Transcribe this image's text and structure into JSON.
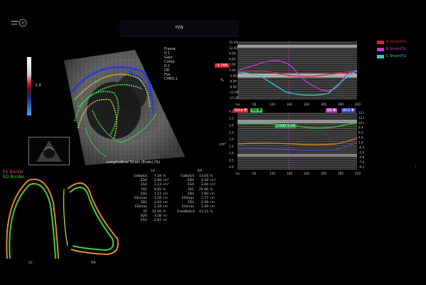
{
  "window": {
    "title": "n/a"
  },
  "logo": {
    "text": ""
  },
  "ultrasound": {
    "caption": "Longitudinal Strain (Endo) (%)",
    "colorbar": {
      "top": "",
      "mid": "-1.4",
      "bottom": ""
    },
    "params": [
      "Frame",
      "0.1",
      "Gain",
      "Comp",
      "0.1",
      "DR",
      "Fps",
      "CHRS-1"
    ]
  },
  "es_legend": [
    {
      "label": "ES Border",
      "color": "#e34a3a"
    },
    {
      "label": "ED Border",
      "color": "#37d14a"
    }
  ],
  "contours": {
    "lv_label": "LV",
    "ra_label": "RA"
  },
  "measurements": {
    "columns": [
      {
        "header": "LV",
        "rows": [
          {
            "name": "GobalLS",
            "value": "-7.28",
            "unit": "%"
          },
          {
            "name": "EDA",
            "value": "2.88",
            "unit": "cm²"
          },
          {
            "name": "ESA",
            "value": "2.23",
            "unit": "cm²"
          },
          {
            "name": "FAC",
            "value": "9.85",
            "unit": "%"
          },
          {
            "name": "EDL",
            "value": "1.11",
            "unit": "cm"
          },
          {
            "name": "ESLmax",
            "value": "3.26",
            "unit": "cm"
          },
          {
            "name": "EDL",
            "value": "2.93",
            "unit": "cm"
          },
          {
            "name": "ESlmax",
            "value": "2.28",
            "unit": "cm"
          },
          {
            "name": "EF",
            "value": "12.56",
            "unit": "%"
          },
          {
            "name": "EDV",
            "value": "3.28",
            "unit": "ml"
          },
          {
            "name": "ESV",
            "value": "2.87",
            "unit": "ml"
          }
        ]
      },
      {
        "header": "RA",
        "rows": [
          {
            "name": "GobalLS",
            "value": "-13.64",
            "unit": "%"
          },
          {
            "name": "EDA",
            "value": "4.58",
            "unit": "cm²"
          },
          {
            "name": "ESA",
            "value": "3.44",
            "unit": "cm²"
          },
          {
            "name": "FAC",
            "value": "25.06",
            "unit": "%"
          },
          {
            "name": "EDL",
            "value": "1.80",
            "unit": "cm"
          },
          {
            "name": "ESlmax",
            "value": "1.77",
            "unit": "cm"
          },
          {
            "name": "EDL",
            "value": "2.08",
            "unit": "cm"
          },
          {
            "name": "ESlmax",
            "value": "1.49",
            "unit": "cm"
          },
          {
            "name": "FreeWallLS",
            "value": "-11.15",
            "unit": "%"
          }
        ]
      }
    ]
  },
  "graph1": {
    "y_ticks": [
      "15.00",
      "12.00",
      "9.00",
      "6.00",
      "3.00",
      "0.00",
      "-3.00",
      "-6.00",
      "-9.00",
      "-12.00",
      "-15.00"
    ],
    "x_ticks": [
      "ms",
      "60",
      "120",
      "180",
      "240",
      "300",
      "360",
      "420"
    ],
    "y_axis_label": "%",
    "marker_label": "-5.066",
    "marker_label_color": "#e3232e"
  },
  "graph2": {
    "y_ticks_left": [
      "4.0",
      "3.5",
      "3.0",
      "2.5",
      "2.0",
      "1.5",
      "1.0",
      "0.5",
      "0.0"
    ],
    "y_ticks_right": [
      "15.0",
      "12.8",
      "10.6",
      "8.4",
      "6.2",
      "4.0",
      "1.8",
      "-0.4",
      "-2.6",
      "-4.8",
      "-7.0",
      "-9.2"
    ],
    "x_ticks": [
      "ms",
      "60",
      "120",
      "180",
      "240",
      "300",
      "360",
      "420"
    ],
    "y_axis_label": "cm²",
    "area_label": "Area ▼",
    "area_label_color": "#e3232e",
    "vol_label": "Vol ▼",
    "vol_label_color": "#39c94a",
    "marker_label": "2.000 5:00",
    "marker_label_color": "#1f9a3a",
    "right_label1": "SR ▼",
    "right_label1_color": "#c13cd0",
    "right_label2": "ACV ▼",
    "right_label2_color": "#3b4fd8"
  },
  "right_legend": [
    {
      "label": "A Strain(%)",
      "color": "#e3232e"
    },
    {
      "label": "B Strain(%)",
      "color": "#c13cd0"
    },
    {
      "label": "C Strain(%)",
      "color": "#37c8c8"
    }
  ],
  "right_edge_label": "..."
}
